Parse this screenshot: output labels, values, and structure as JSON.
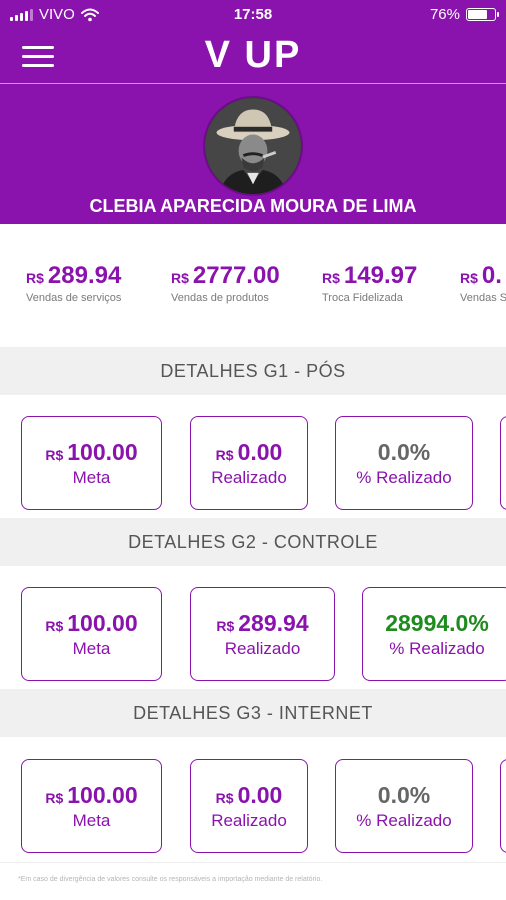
{
  "status_bar": {
    "carrier": "VIVO",
    "time": "17:58",
    "battery": "76%",
    "battery_level": 0.76
  },
  "header": {
    "logo": "V UP",
    "user_name": "CLEBIA APARECIDA MOURA DE LIMA"
  },
  "summary": [
    {
      "currency": "R$",
      "value": "289.94",
      "label": "Vendas de serviços"
    },
    {
      "currency": "R$",
      "value": "2777.00",
      "label": "Vendas de produtos"
    },
    {
      "currency": "R$",
      "value": "149.97",
      "label": "Troca Fidelizada"
    },
    {
      "currency": "R$",
      "value": "0.",
      "label": "Vendas S"
    }
  ],
  "sections": [
    {
      "title": "DETALHES G1 - PÓS",
      "cards": [
        {
          "currency": "R$",
          "value": "100.00",
          "label": "Meta"
        },
        {
          "currency": "R$",
          "value": "0.00",
          "label": "Realizado"
        },
        {
          "currency": "",
          "value": "0.0%",
          "label": "% Realizado"
        }
      ]
    },
    {
      "title": "DETALHES G2 - CONTROLE",
      "cards": [
        {
          "currency": "R$",
          "value": "100.00",
          "label": "Meta"
        },
        {
          "currency": "R$",
          "value": "289.94",
          "label": "Realizado"
        },
        {
          "currency": "",
          "value": "28994.0%",
          "label": "% Realizado"
        }
      ]
    },
    {
      "title": "DETALHES G3 - INTERNET",
      "cards": [
        {
          "currency": "R$",
          "value": "100.00",
          "label": "Meta"
        },
        {
          "currency": "R$",
          "value": "0.00",
          "label": "Realizado"
        },
        {
          "currency": "",
          "value": "0.0%",
          "label": "% Realizado"
        }
      ]
    }
  ],
  "footnote": "*Em caso de divergência de valores consulte os responsáveis a importação mediante de relatório.",
  "colors": {
    "brand": "#8a13ad",
    "positive": "#1d8b1d",
    "neutral": "#666666"
  },
  "icons": {
    "menu": "hamburger-menu-icon",
    "wifi": "wifi-icon",
    "battery": "battery-icon",
    "signal": "signal-icon"
  }
}
